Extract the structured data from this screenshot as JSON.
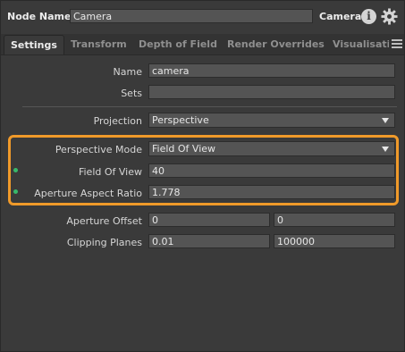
{
  "header": {
    "node_name_label": "Node Name",
    "node_name_value": "Camera",
    "node_type": "Camera",
    "info_icon_glyph": "i"
  },
  "tabs": [
    {
      "label": "Settings",
      "active": true
    },
    {
      "label": "Transform",
      "active": false
    },
    {
      "label": "Depth of Field",
      "active": false
    },
    {
      "label": "Render Overrides",
      "active": false
    },
    {
      "label": "Visualisatio",
      "active": false
    }
  ],
  "settings": {
    "name": {
      "label": "Name",
      "value": "camera"
    },
    "sets": {
      "label": "Sets",
      "value": ""
    },
    "projection": {
      "label": "Projection",
      "value": "Perspective"
    },
    "perspective_mode": {
      "label": "Perspective Mode",
      "value": "Field Of View"
    },
    "field_of_view": {
      "label": "Field Of View",
      "value": "40"
    },
    "aperture_aspect_ratio": {
      "label": "Aperture Aspect Ratio",
      "value": "1.778"
    },
    "aperture_offset": {
      "label": "Aperture Offset",
      "values": [
        "0",
        "0"
      ]
    },
    "clipping_planes": {
      "label": "Clipping Planes",
      "values": [
        "0.01",
        "100000"
      ]
    }
  },
  "colors": {
    "highlight": "#f09a2a",
    "animated_dot": "#38b86a",
    "background": "#3a3a3a",
    "field_bg": "#545454"
  }
}
